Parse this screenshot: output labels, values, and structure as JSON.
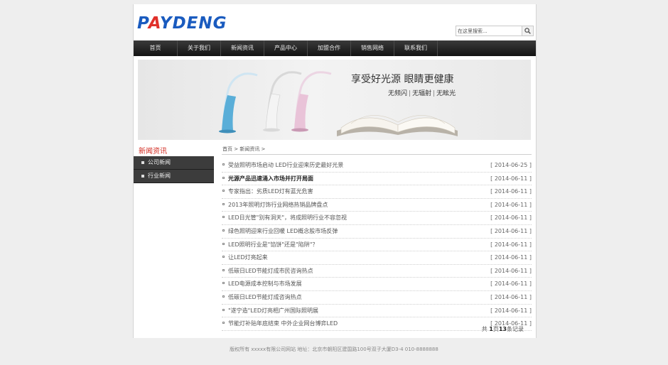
{
  "header": {
    "logo_text_a": "P",
    "logo_text_b": "A",
    "logo_text_c": "YDENG",
    "search_placeholder": "在这里搜索..."
  },
  "nav": {
    "items": [
      "首页",
      "关于我们",
      "新闻资讯",
      "产品中心",
      "加盟合作",
      "销售网络",
      "联系我们"
    ]
  },
  "banner": {
    "slogan": "享受好光源 眼睛更健康",
    "tags": [
      "无频闪",
      "无辐射",
      "无眩光"
    ],
    "tag_separator": "|"
  },
  "sidebar": {
    "title": "新闻资讯",
    "items": [
      "公司新闻",
      "行业新闻"
    ]
  },
  "breadcrumb": "首页 > 新闻资讯 >",
  "news": [
    {
      "title": "受益照明市场启动 LED行业迎来历史最好光景",
      "date": "[ 2014-06-25 ]",
      "bold": false
    },
    {
      "title": "光源产品迅速涌入市场并打开局面",
      "date": "[ 2014-06-11 ]",
      "bold": true
    },
    {
      "title": "专家指出：劣质LED灯有蓝光危害",
      "date": "[ 2014-06-11 ]",
      "bold": false
    },
    {
      "title": "2013年照明灯饰行业网络热销品牌盘点",
      "date": "[ 2014-06-11 ]",
      "bold": false
    },
    {
      "title": "LED日光管\"别有洞天\"，将成照明行业不容忽视",
      "date": "[ 2014-06-11 ]",
      "bold": false
    },
    {
      "title": "绿色照明迎来行业回暖 LED概念股市场反弹",
      "date": "[ 2014-06-11 ]",
      "bold": false
    },
    {
      "title": "LED照明行业是\"馅饼\"还是\"陷阱\"？",
      "date": "[ 2014-06-11 ]",
      "bold": false
    },
    {
      "title": "让LED灯亮起来",
      "date": "[ 2014-06-11 ]",
      "bold": false
    },
    {
      "title": "低碳日LED节能灯成市民咨询热点",
      "date": "[ 2014-06-11 ]",
      "bold": false
    },
    {
      "title": "LED电源成本控制与市场发展",
      "date": "[ 2014-06-11 ]",
      "bold": false
    },
    {
      "title": "低碳日LED节能灯成咨询热点",
      "date": "[ 2014-06-11 ]",
      "bold": false
    },
    {
      "title": "\"遂宁造\"LED灯亮相广州国际照明展",
      "date": "[ 2014-06-11 ]",
      "bold": false
    },
    {
      "title": "节能灯补贴年底结束 中外企业网台博弈LED",
      "date": "[ 2014-06-11 ]",
      "bold": false
    }
  ],
  "pager": {
    "prefix": "共",
    "pages": "1",
    "middle": "页",
    "count": "13",
    "suffix": "条记录"
  },
  "footer": "版权所有 xxxxx有限公司网站 地址：北京市朝阳区建国路100号双子大厦D3-4 010-8888888",
  "colors": {
    "logo_blue": "#1a5bbf",
    "logo_red": "#e0302a",
    "sidebar_title": "#d22a20",
    "nav_bg": "#1e1e1e",
    "sidebar_bg": "#3c3c3c"
  }
}
